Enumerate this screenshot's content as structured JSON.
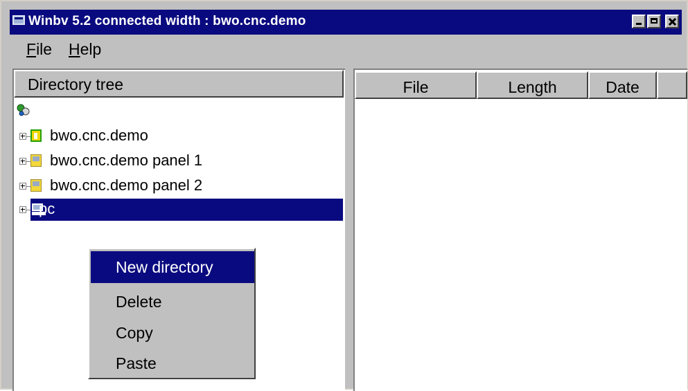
{
  "window": {
    "title": "Winbv 5.2 connected width : bwo.cnc.demo"
  },
  "menubar": {
    "items": [
      {
        "label": "File",
        "mnemonic": "F",
        "rest": "ile"
      },
      {
        "label": "Help",
        "mnemonic": "H",
        "rest": "elp"
      }
    ]
  },
  "tree": {
    "header": "Directory tree",
    "root_icon": "network-icon",
    "items": [
      {
        "label": "bwo.cnc.demo",
        "icon": "device-green-icon"
      },
      {
        "label": "bwo.cnc.demo panel 1",
        "icon": "panel-icon"
      },
      {
        "label": "bwo.cnc.demo panel 2",
        "icon": "panel-icon"
      },
      {
        "label": "pc",
        "icon": "computer-icon",
        "selected": true
      }
    ]
  },
  "file_list": {
    "columns": [
      "File",
      "Length",
      "Date"
    ]
  },
  "context_menu": {
    "items": [
      {
        "label": "New directory",
        "highlighted": true
      },
      {
        "label": "Delete"
      },
      {
        "label": "Copy"
      },
      {
        "label": "Paste"
      }
    ]
  },
  "colors": {
    "selection": "#0a0a80",
    "face": "#c0c0c0"
  }
}
